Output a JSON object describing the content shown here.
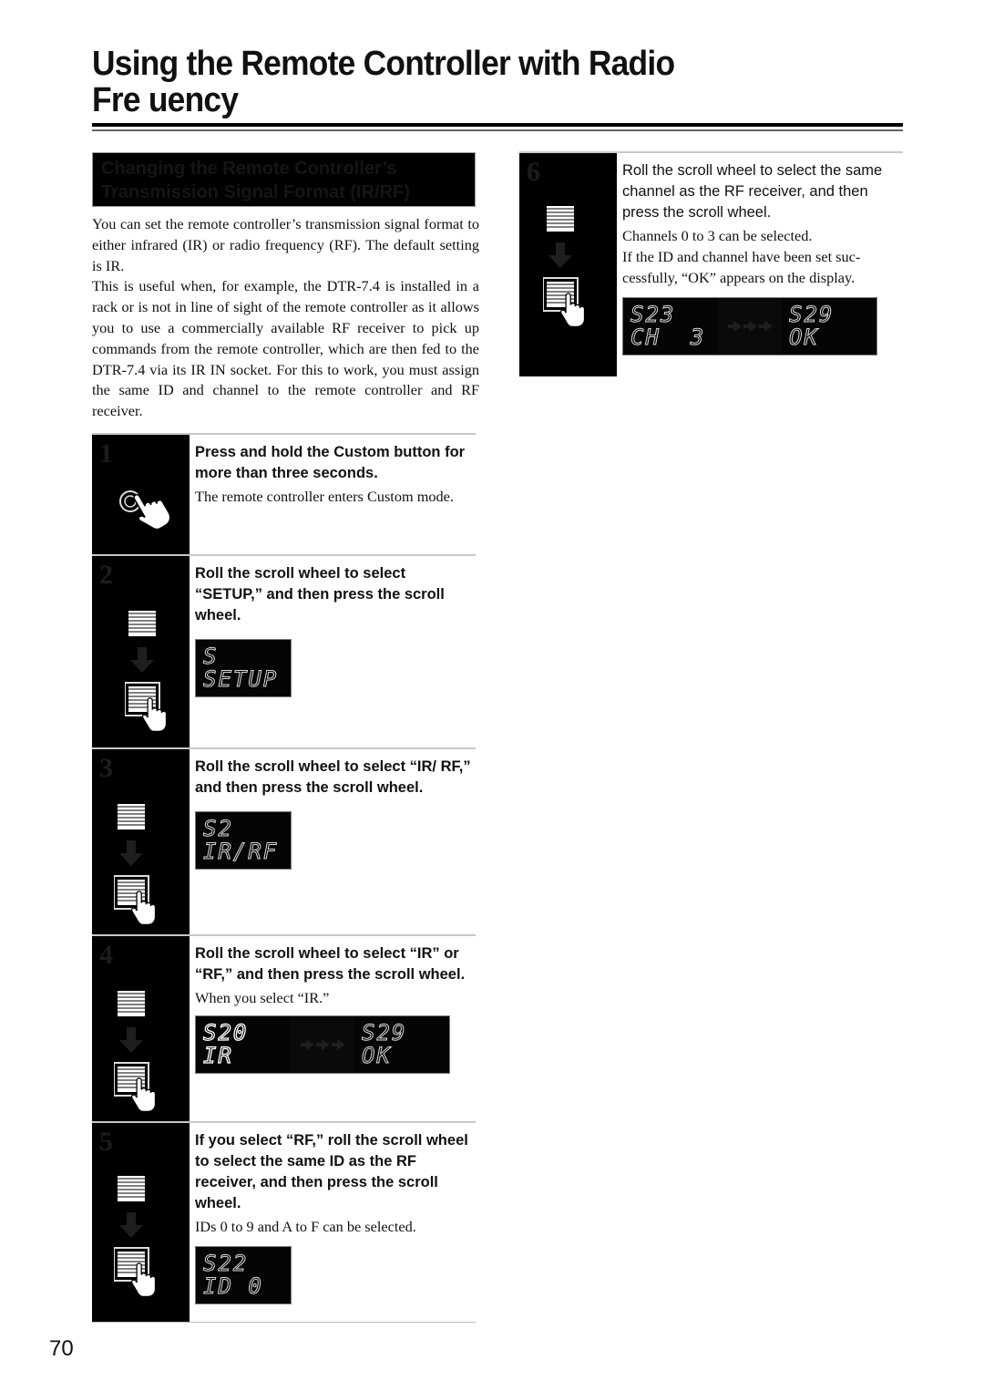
{
  "page": {
    "title_line1": "Using the Remote Controller with Radio",
    "title_line2": "Fre  uency",
    "page_number": "70"
  },
  "section": {
    "heading_line1": "Changing the Remote Controller’s",
    "heading_line2": "Transmission Signal Format (IR/RF)",
    "intro_paragraphs": [
      "You can set the remote controller’s transmission signal format to either infrared (IR) or radio frequency (RF). The default setting is IR.",
      "This is useful when, for example, the DTR-7.4 is installed in a rack or is not in line of sight of the remote controller as it allows you to use a commercially available RF receiver to pick up commands from the remote controller, which are then fed to the DTR-7.4 via its IR IN socket. For this to work, you must assign the same ID and channel to the remote controller and RF receiver."
    ]
  },
  "steps": [
    {
      "number": "1",
      "icon": "press-button-icon",
      "heading": "Press and hold the Custom button for more than three seconds.",
      "note": "The remote controller enters Custom mode.",
      "displays": []
    },
    {
      "number": "2",
      "icon": "scroll-wheel-icon",
      "heading": "Roll the scroll wheel to select “SETUP,” and then press the scroll wheel.",
      "note": "",
      "displays": [
        {
          "line1": "S",
          "line2": "SETUP"
        }
      ]
    },
    {
      "number": "3",
      "icon": "scroll-wheel-icon",
      "heading": "Roll the scroll wheel to select “IR/ RF,” and then press the scroll wheel.",
      "note": "",
      "displays": [
        {
          "line1": "S2",
          "line2": "IR/RF"
        }
      ]
    },
    {
      "number": "4",
      "icon": "scroll-wheel-icon",
      "heading": "Roll the scroll wheel to select “IR” or “RF,” and then press the scroll wheel.",
      "note": "When you select “IR.”",
      "displays": [
        {
          "line1": "S20",
          "line2": "IR"
        },
        {
          "line1": "S29",
          "line2": "OK"
        }
      ]
    },
    {
      "number": "5",
      "icon": "scroll-wheel-icon",
      "heading": "If you select “RF,” roll the scroll wheel to select the same ID as the RF receiver, and then press the scroll wheel.",
      "note": "IDs 0 to 9 and A to F can be selected.",
      "displays": [
        {
          "line1": "S22",
          "line2": "ID 0"
        }
      ]
    },
    {
      "number": "6",
      "icon": "scroll-wheel-icon",
      "heading": "Roll the scroll wheel to select the same channel as the RF receiver, and then press the scroll wheel.",
      "note": "Channels 0 to 3 can be selected.",
      "note2": "If the ID and channel have been set suc-cessfully, “OK” appears on the display.",
      "displays": [
        {
          "line1": "S23",
          "line2": "CH  3"
        },
        {
          "line1": "S29",
          "line2": "OK"
        }
      ]
    }
  ]
}
